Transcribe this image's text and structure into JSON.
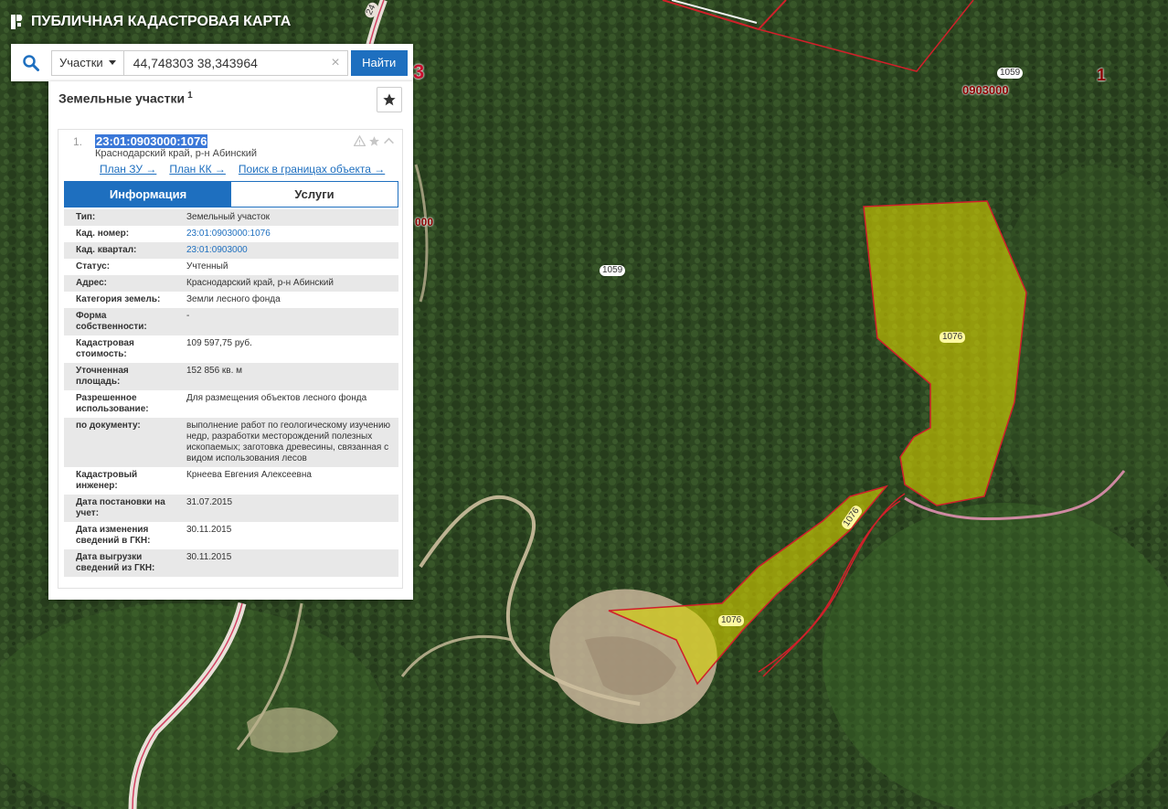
{
  "app": {
    "title": "ПУБЛИЧНАЯ КАДАСТРОВАЯ КАРТА"
  },
  "search": {
    "type_label": "Участки",
    "query": "44,748303 38,343964",
    "clear_symbol": "×",
    "find_label": "Найти"
  },
  "panel": {
    "title": "Земельные участки",
    "count": "1"
  },
  "result": {
    "index": "1.",
    "cadnum": "23:01:0903000:1076",
    "address": "Краснодарский край, р-н Абинский",
    "links": {
      "plan_zu": "План ЗУ →",
      "plan_kk": "План КК →",
      "search_bounds": "Поиск в границах объекта →"
    },
    "tabs": {
      "info": "Информация",
      "services": "Услуги"
    },
    "rows": [
      {
        "label": "Тип:",
        "value": "Земельный участок"
      },
      {
        "label": "Кад. номер:",
        "value": "23:01:0903000:1076"
      },
      {
        "label": "Кад. квартал:",
        "value": "23:01:0903000"
      },
      {
        "label": "Статус:",
        "value": "Учтенный"
      },
      {
        "label": "Адрес:",
        "value": "Краснодарский край, р-н Абинский"
      },
      {
        "label": "Категория земель:",
        "value": "Земли лесного фонда"
      },
      {
        "label": "Форма собственности:",
        "value": "-"
      },
      {
        "label": "Кадастровая стоимость:",
        "value": "109 597,75 руб."
      },
      {
        "label": "Уточненная площадь:",
        "value": "152 856 кв. м"
      },
      {
        "label": "Разрешенное использование:",
        "value": "Для размещения объектов лесного фонда"
      },
      {
        "label": "по документу:",
        "value": "выполнение работ по геологическому изучению недр, разработки месторождений полезных ископаемых; заготовка древесины, связанная с видом использования лесов"
      },
      {
        "label": "Кадастровый инженер:",
        "value": "Крнеева Евгения Алексеевна"
      },
      {
        "label": "Дата постановки на учет:",
        "value": "31.07.2015"
      },
      {
        "label": "Дата изменения сведений в ГКН:",
        "value": "30.11.2015"
      },
      {
        "label": "Дата выгрузки сведений из ГКН:",
        "value": "30.11.2015"
      }
    ]
  },
  "map": {
    "labels": {
      "parcel_1059_top": "1059",
      "parcel_1059_mid": "1059",
      "quarter_0903000": "0903000",
      "quarter_left": "000",
      "number_1": "1",
      "number_3": "3",
      "road_24": "24",
      "parcel_1076_a": "1076",
      "parcel_1076_b": "1076",
      "parcel_1076_c": "1076"
    },
    "colors": {
      "forest": "#2f4a22",
      "parcel_fill": "#d8d400",
      "boundary": "#d0202a",
      "accent": "#1e6fbf"
    }
  }
}
